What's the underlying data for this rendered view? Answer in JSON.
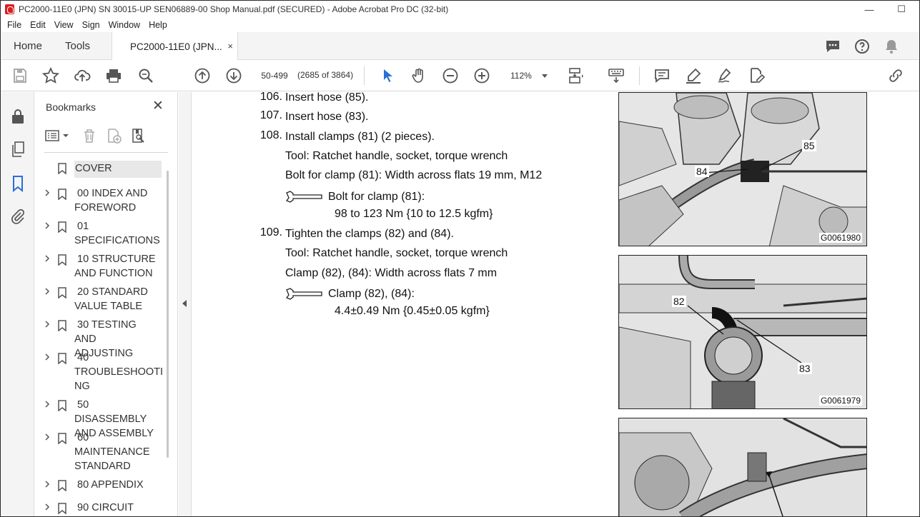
{
  "window": {
    "title": "PC2000-11E0 (JPN) SN 30015-UP SEN06889-00 Shop Manual.pdf (SECURED) - Adobe Acrobat Pro DC (32-bit)",
    "minimize": "—",
    "maximize": "☐"
  },
  "menu": [
    "File",
    "Edit",
    "View",
    "Sign",
    "Window",
    "Help"
  ],
  "tabs": {
    "home": "Home",
    "tools": "Tools",
    "doc": "PC2000-11E0 (JPN...",
    "close": "×"
  },
  "toolbar": {
    "page_field": "50-499",
    "page_count": "(2685 of 3864)",
    "zoom": "112%"
  },
  "bookmarks": {
    "title": "Bookmarks",
    "close": "✕",
    "items": [
      {
        "label": "COVER",
        "expandable": false,
        "selected": true
      },
      {
        "label": " 00 INDEX AND\nFOREWORD",
        "expandable": true
      },
      {
        "label": " 01\nSPECIFICATIONS",
        "expandable": true
      },
      {
        "label": " 10 STRUCTURE\nAND FUNCTION",
        "expandable": true
      },
      {
        "label": " 20 STANDARD\nVALUE TABLE",
        "expandable": true
      },
      {
        "label": " 30 TESTING AND\nADJUSTING",
        "expandable": true
      },
      {
        "label": " 40\nTROUBLESHOOTI\nNG",
        "expandable": true
      },
      {
        "label": " 50 DISASSEMBLY\nAND ASSEMBLY",
        "expandable": true
      },
      {
        "label": " 60\nMAINTENANCE\nSTANDARD",
        "expandable": true
      },
      {
        "label": " 80 APPENDIX",
        "expandable": true
      },
      {
        "label": " 90 CIRCUIT",
        "expandable": true
      }
    ]
  },
  "document": {
    "steps": [
      {
        "num": "106.",
        "text": "Insert hose (85)."
      },
      {
        "num": "107.",
        "text": "Insert hose (83)."
      },
      {
        "num": "108.",
        "text": "Install clamps (81) (2 pieces)."
      }
    ],
    "step108_tool": "Tool: Ratchet handle, socket, torque wrench",
    "step108_bolt": "Bolt for clamp (81): Width across flats 19 mm, M12",
    "step108_torque_label": "Bolt for clamp (81):",
    "step108_torque_value": "98 to 123 Nm {10 to 12.5 kgfm}",
    "step109_num": "109.",
    "step109_text": "Tighten the clamps (82) and (84).",
    "step109_tool": "Tool: Ratchet handle, socket, torque wrench",
    "step109_clamp": "Clamp (82), (84): Width across flats 7 mm",
    "step109_torque_label": "Clamp (82), (84):",
    "step109_torque_value": "4.4±0.49 Nm {0.45±0.05 kgfm}",
    "figures": [
      {
        "code": "G0061980",
        "callouts": [
          "84",
          "85"
        ]
      },
      {
        "code": "G0061979",
        "callouts": [
          "82",
          "83"
        ]
      },
      {
        "code": ""
      }
    ]
  }
}
